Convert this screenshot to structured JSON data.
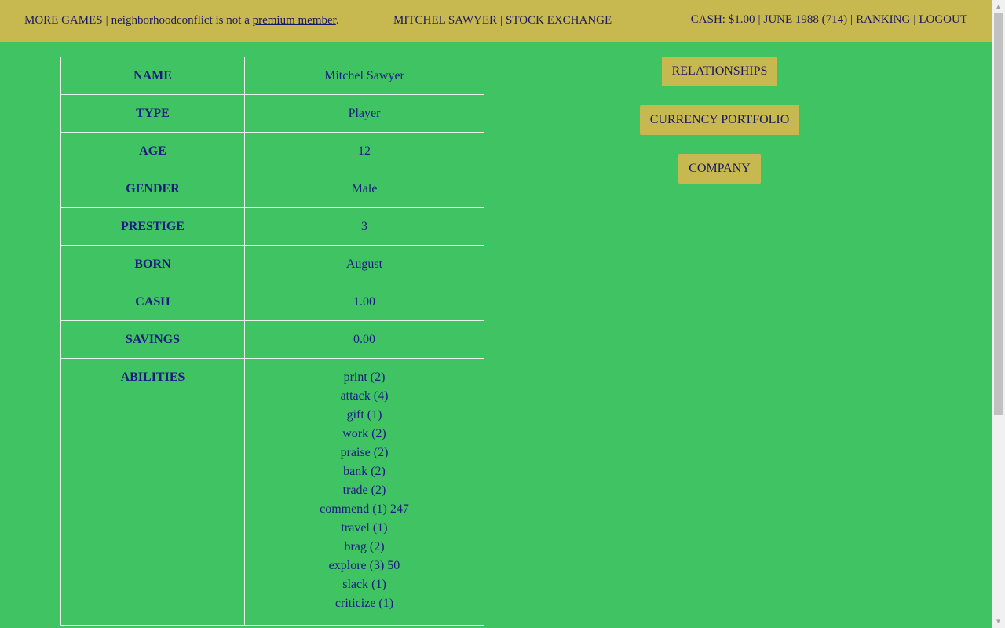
{
  "header": {
    "more_games": "MORE GAMES",
    "sep": "|",
    "username": "neighborhoodconflict",
    "not_premium_text": "is not a",
    "premium_link": "premium member",
    "period": ".",
    "player_name": "MITCHEL SAWYER",
    "stock_exchange": "STOCK EXCHANGE",
    "cash": "CASH: $1.00",
    "date": "JUNE 1988 (714)",
    "ranking": "RANKING",
    "logout": "LOGOUT"
  },
  "profile": {
    "rows": [
      {
        "label": "NAME",
        "value": "Mitchel Sawyer"
      },
      {
        "label": "TYPE",
        "value": "Player"
      },
      {
        "label": "AGE",
        "value": "12"
      },
      {
        "label": "GENDER",
        "value": "Male"
      },
      {
        "label": "PRESTIGE",
        "value": "3"
      },
      {
        "label": "BORN",
        "value": "August"
      },
      {
        "label": "CASH",
        "value": "1.00"
      },
      {
        "label": "SAVINGS",
        "value": "0.00"
      }
    ],
    "abilities_label": "ABILITIES",
    "abilities": [
      "print (2)",
      "attack (4)",
      "gift (1)",
      "work (2)",
      "praise (2)",
      "bank (2)",
      "trade (2)",
      "commend (1) 247",
      "travel (1)",
      "brag (2)",
      "explore (3) 50",
      "slack (1)",
      "criticize (1)"
    ]
  },
  "actions": {
    "relationships": "RELATIONSHIPS",
    "currency_portfolio": "CURRENCY PORTFOLIO",
    "company": "COMPANY"
  },
  "colors": {
    "background": "#40c463",
    "header": "#c8b850",
    "text": "#1a1a80"
  }
}
